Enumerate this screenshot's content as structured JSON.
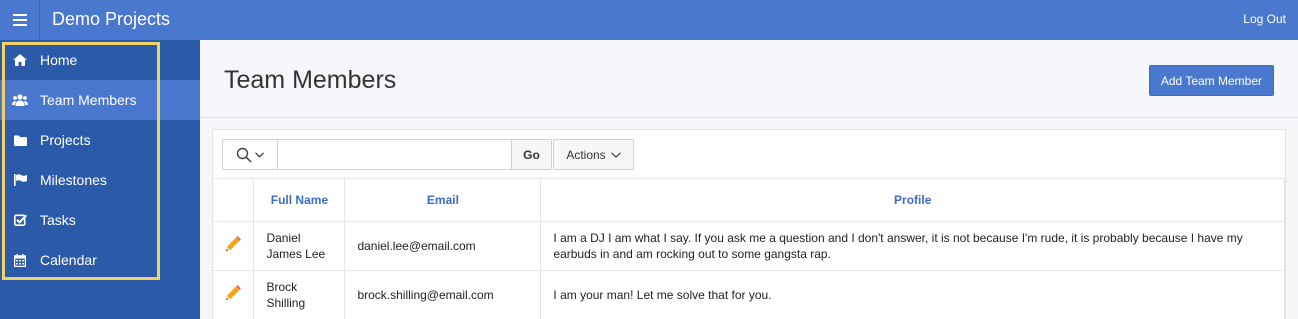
{
  "app": {
    "title": "Demo Projects",
    "logout_label": "Log Out"
  },
  "sidebar": {
    "items": [
      {
        "label": "Home",
        "icon": "home-icon"
      },
      {
        "label": "Team Members",
        "icon": "users-icon",
        "active": true
      },
      {
        "label": "Projects",
        "icon": "folder-icon"
      },
      {
        "label": "Milestones",
        "icon": "flag-icon"
      },
      {
        "label": "Tasks",
        "icon": "check-square-icon"
      },
      {
        "label": "Calendar",
        "icon": "calendar-icon"
      }
    ]
  },
  "page": {
    "title": "Team Members",
    "add_button_label": "Add Team Member"
  },
  "report": {
    "search": {
      "value": "",
      "go_label": "Go"
    },
    "actions_label": "Actions",
    "columns": [
      "Full Name",
      "Email",
      "Profile"
    ],
    "rows": [
      {
        "full_name": "Daniel James Lee",
        "email": "daniel.lee@email.com",
        "profile": "I am a DJ I am what I say. If you ask me a question and I don't answer, it is not because I'm rude, it is probably because I have my earbuds in and am rocking out to some gangsta rap."
      },
      {
        "full_name": "Brock Shilling",
        "email": "brock.shilling@email.com",
        "profile": "I am your man! Let me solve that for you."
      }
    ]
  },
  "colors": {
    "header_bg": "#4a78cf",
    "sidebar_bg": "#2b5ba8",
    "active_item_bg": "#4a78cf",
    "highlight_outline": "#f2d264",
    "link_blue": "#3b6cc7"
  }
}
